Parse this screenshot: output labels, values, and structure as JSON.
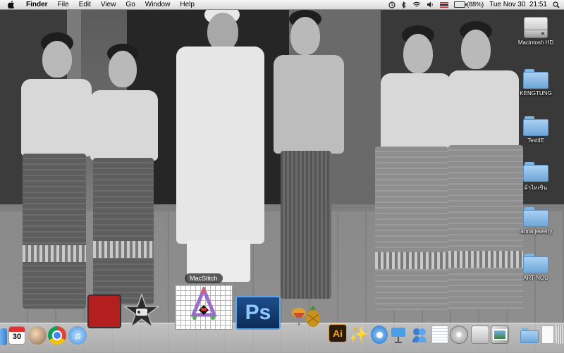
{
  "menubar": {
    "app_name": "Finder",
    "menus": [
      "File",
      "Edit",
      "View",
      "Go",
      "Window",
      "Help"
    ],
    "battery_text": "(88%)",
    "battery_level": 0.88,
    "clock": "Tue Nov 30  21:51",
    "icons": [
      "apple-icon",
      "time-machine-icon",
      "bluetooth-icon",
      "wifi-icon",
      "volume-icon",
      "flag-icon",
      "battery-icon",
      "spotlight-icon"
    ]
  },
  "desktop": {
    "icons": [
      {
        "label": "Macintosh HD",
        "kind": "hard-drive-icon"
      },
      {
        "label": "KENGTUNG",
        "kind": "folder-icon"
      },
      {
        "label": "TextilE",
        "kind": "folder-icon"
      },
      {
        "label": "ผ้าไทเขิน",
        "kind": "folder-icon"
      },
      {
        "label": "lanna jewelry",
        "kind": "folder-icon"
      },
      {
        "label": "ART NOU",
        "kind": "folder-icon"
      }
    ]
  },
  "dock": {
    "tooltip": "MacStitch",
    "calendar_day": "30",
    "ps_label": "Ps",
    "ai_label": "Ai",
    "apps": [
      "finder-icon",
      "calendar-icon",
      "preview-icon",
      "chrome-icon",
      "itunes-icon",
      "photo-booth-icon",
      "imovie-icon",
      "macstitch-icon",
      "photoshop-icon",
      "front-row-icon",
      "illustrator-icon",
      "dictionary-icon",
      "quicktime-icon",
      "keynote-icon",
      "ichat-icon",
      "textedit-icon",
      "disk-utility-icon",
      "system-preferences-icon",
      "iphoto-icon",
      "downloads-stack-icon",
      "documents-stack-icon",
      "trash-icon"
    ]
  },
  "colors": {
    "folder_blue": "#8cc0ec",
    "menubar_bg": "#e8e8e8",
    "ps_blue": "#1d4f8c",
    "ai_orange": "#f3a11e"
  }
}
